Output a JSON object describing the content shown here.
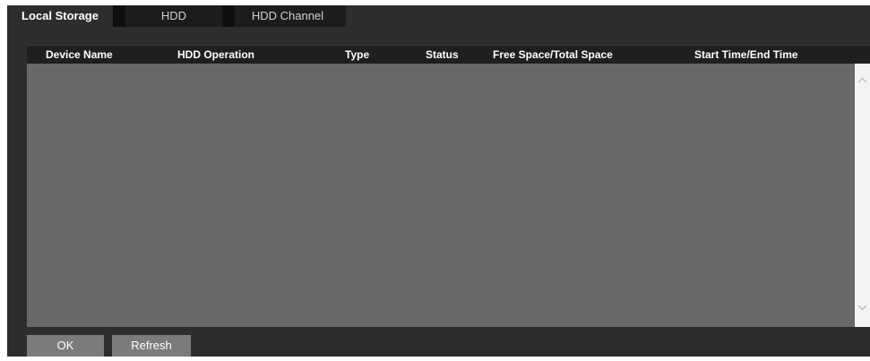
{
  "tabs": [
    {
      "label": "Local Storage",
      "active": true
    },
    {
      "label": "HDD",
      "active": false
    },
    {
      "label": "HDD Channel",
      "active": false
    }
  ],
  "table": {
    "columns": [
      "Device Name",
      "HDD Operation",
      "Type",
      "Status",
      "Free Space/Total Space",
      "Start Time/End Time"
    ],
    "rows": []
  },
  "buttons": {
    "ok": "OK",
    "refresh": "Refresh"
  },
  "colors": {
    "background": "#2d2d2d",
    "tabbar": "#1c1c1c",
    "table_header": "#1f1f1f",
    "table_body": "#686868",
    "button": "#7b7b7b",
    "scrollbar": "#f3f3f3"
  },
  "icons": {
    "scroll_up": "chevron-up-icon",
    "scroll_down": "chevron-down-icon"
  }
}
